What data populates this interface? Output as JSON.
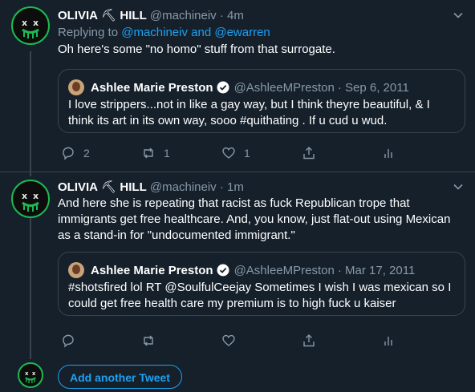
{
  "tweets": [
    {
      "name": "OLIVIA",
      "name_suffix": "HILL",
      "handle": "@machineiv",
      "time": "· 4m",
      "replying_prefix": "Replying to ",
      "replying_to_1": "@machineiv",
      "replying_and": " and ",
      "replying_to_2": "@ewarren",
      "text": "Oh here's some \"no homo\" stuff from that surrogate.",
      "quote": {
        "name": "Ashlee Marie Preston",
        "handle": "@AshleeMPreston",
        "date": "· Sep 6, 2011",
        "text": "I love strippers...not in like a gay way, but I think theyre beautiful, & I think its art in its own way, sooo #quithating . If u cud u wud."
      },
      "reply_count": "2",
      "retweet_count": "1",
      "like_count": "1"
    },
    {
      "name": "OLIVIA",
      "name_suffix": "HILL",
      "handle": "@machineiv",
      "time": "· 1m",
      "text": "And here she is repeating that racist as fuck Republican trope that immigrants get free healthcare. And, you know, just flat-out using Mexican as a stand-in for \"undocumented immigrant.\"",
      "quote": {
        "name": "Ashlee Marie Preston",
        "handle": "@AshleeMPreston",
        "date": "· Mar 17, 2011",
        "text": "#shotsfired lol RT @SoulfulCeejay Sometimes I wish I was mexican so I could get free health care my premium is to high fuck u kaiser"
      }
    }
  ],
  "add_tweet_label": "Add another Tweet",
  "colors": {
    "background": "#15202b",
    "accent": "#1da1f2",
    "border": "#38444d",
    "muted": "#8899a6",
    "avatar_ring": "#1db954"
  }
}
